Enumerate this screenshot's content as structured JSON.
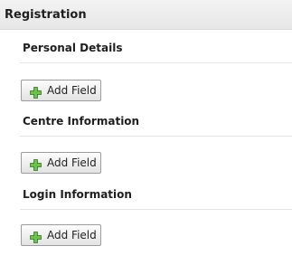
{
  "header": {
    "title": "Registration"
  },
  "sections": [
    {
      "title": "Personal Details",
      "button_label": "Add Field"
    },
    {
      "title": "Centre Information",
      "button_label": "Add Field"
    },
    {
      "title": "Login Information",
      "button_label": "Add Field"
    }
  ],
  "icons": {
    "add_icon": "plus-icon"
  },
  "colors": {
    "plus_icon": "#4d9a2f",
    "header_bg": "#ececec",
    "divider": "#e4e4e4"
  }
}
